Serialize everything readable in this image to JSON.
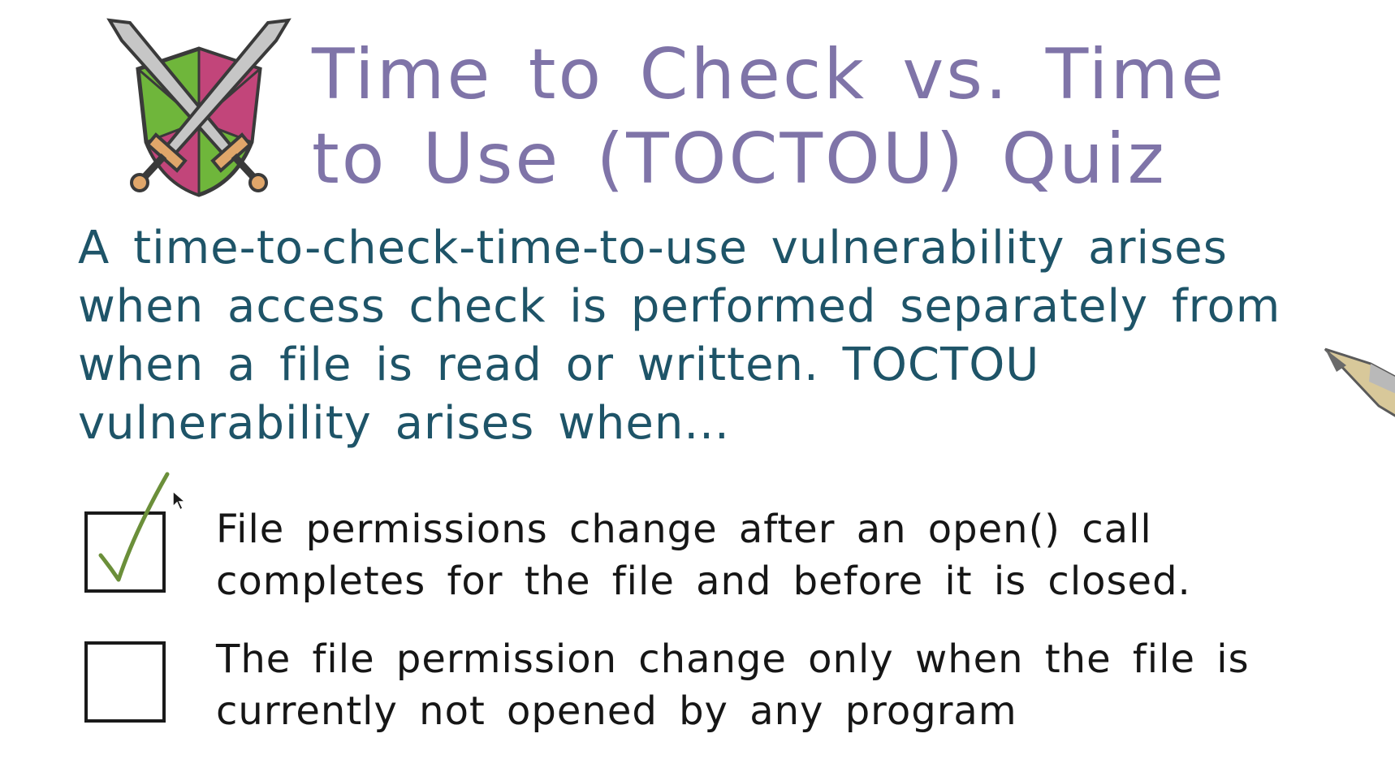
{
  "slide": {
    "title": "Time to Check vs. Time to Use (TOCTOU) Quiz",
    "question": "A time-to-check-time-to-use vulnerability arises when access check is performed separately from when a file is read or written. TOCTOU vulnerability arises when...",
    "options": [
      {
        "label": "File permissions change after an open() call completes for the file and before it is closed.",
        "checked": true
      },
      {
        "label": "The file permission change only when the file is currently not opened by any program",
        "checked": false
      }
    ]
  },
  "icons": {
    "logo": "crossed-swords-shield-icon",
    "checkmark": "checkmark-icon",
    "cursor": "mouse-cursor-icon",
    "pen": "pen-tip-icon"
  },
  "colors": {
    "title": "#7f74a8",
    "question": "#1e5468",
    "option_text": "#161616",
    "checkmark": "#6b8f3a",
    "shield_green": "#6fb63b",
    "shield_magenta": "#c2457a",
    "blade": "#b9b9b9"
  }
}
